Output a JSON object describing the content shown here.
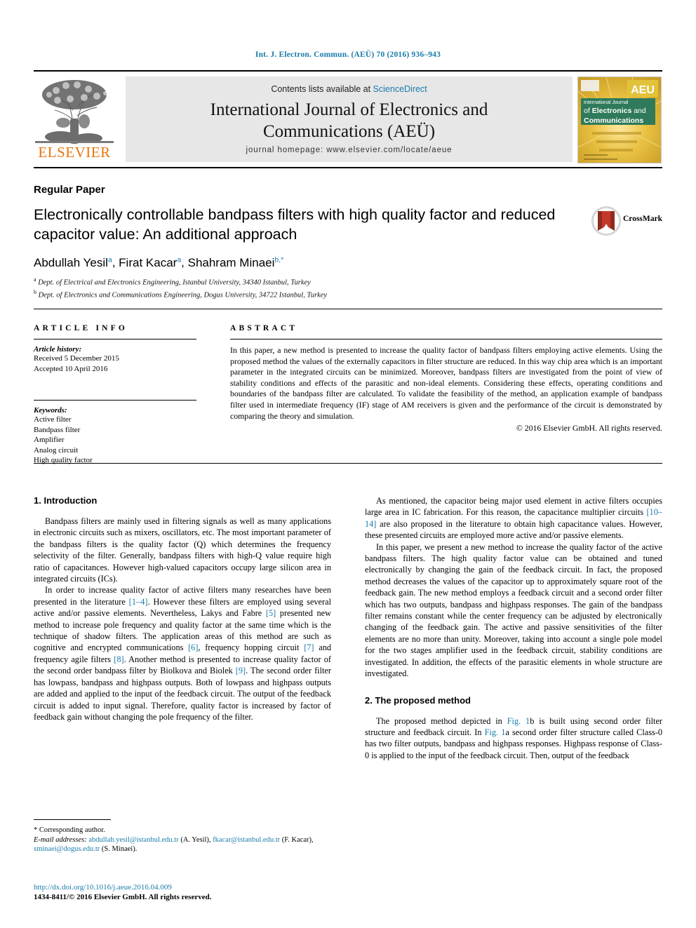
{
  "running_head": "Int. J. Electron. Commun. (AEÜ) 70 (2016) 936–943",
  "masthead": {
    "publisher_name": "ELSEVIER",
    "contents_prefix": "Contents lists available at ",
    "contents_link": "ScienceDirect",
    "journal_title_line1": "International Journal of Electronics and",
    "journal_title_line2": "Communications (AEÜ)",
    "homepage": "journal homepage: www.elsevier.com/locate/aeue",
    "cover_line1": "International Journal",
    "cover_line2": "of Electronics and",
    "cover_line3": "Communications",
    "cover_badge": "AEU"
  },
  "title_block": {
    "paper_kind": "Regular Paper",
    "title": "Electronically controllable bandpass filters with high quality factor and reduced capacitor value: An additional approach",
    "crossmark_label": "CrossMark",
    "authors": [
      {
        "name": "Abdullah Yesil",
        "marks": "a"
      },
      {
        "name": "Firat Kacar",
        "marks": "a"
      },
      {
        "name": "Shahram Minaei",
        "marks": "b,*"
      }
    ],
    "affiliations": [
      {
        "mark": "a",
        "text": "Dept. of Electrical and Electronics Engineering, Istanbul University, 34340 Istanbul, Turkey"
      },
      {
        "mark": "b",
        "text": "Dept. of Electronics and Communications Engineering, Dogus University, 34722 Istanbul, Turkey"
      }
    ]
  },
  "article_info": {
    "heading": "ARTICLE INFO",
    "history_label": "Article history:",
    "history_lines": [
      "Received 5 December 2015",
      "Accepted 10 April 2016"
    ],
    "keywords_label": "Keywords:",
    "keywords": [
      "Active filter",
      "Bandpass filter",
      "Amplifier",
      "Analog circuit",
      "High quality factor"
    ]
  },
  "abstract": {
    "heading": "ABSTRACT",
    "text": "In this paper, a new method is presented to increase the quality factor of bandpass filters employing active elements. Using the proposed method the values of the externally capacitors in filter structure are reduced. In this way chip area which is an important parameter in the integrated circuits can be minimized. Moreover, bandpass filters are investigated from the point of view of stability conditions and effects of the parasitic and non-ideal elements. Considering these effects, operating conditions and boundaries of the bandpass filter are calculated. To validate the feasibility of the method, an application example of bandpass filter used in intermediate frequency (IF) stage of AM receivers is given and the performance of the circuit is demonstrated by comparing the theory and simulation.",
    "copyright": "© 2016 Elsevier GmbH. All rights reserved."
  },
  "body": {
    "section1_heading": "1. Introduction",
    "section1_p1": "Bandpass filters are mainly used in filtering signals as well as many applications in electronic circuits such as mixers, oscillators, etc. The most important parameter of the bandpass filters is the quality factor (Q) which determines the frequency selectivity of the filter. Generally, bandpass filters with high-Q value require high ratio of capacitances. However high-valued capacitors occupy large silicon area in integrated circuits (ICs).",
    "section1_p2_a": "In order to increase quality factor of active filters many researches have been presented in the literature ",
    "ref_1_4": "[1–4]",
    "section1_p2_b": ". However these filters are employed using several active and/or passive elements. Nevertheless, Lakys and Fabre ",
    "ref_5": "[5]",
    "section1_p2_c": " presented new method to increase pole frequency and quality factor at the same time which is the technique of shadow filters. The application areas of this method are such as cognitive and encrypted communications ",
    "ref_6": "[6]",
    "section1_p2_d": ", frequency hopping circuit ",
    "ref_7": "[7]",
    "section1_p2_e": " and frequency agile filters ",
    "ref_8": "[8]",
    "section1_p2_f": ". Another method is presented to increase quality factor of the second order bandpass filter by Biolkova and Biolek ",
    "ref_9": "[9]",
    "section1_p2_g": ". The second order filter has lowpass, bandpass and highpass outputs. Both of lowpass and highpass outputs are added and applied to the input of the feedback circuit. The output of the feedback circuit is added to input signal. Therefore, quality factor is increased by factor of feedback gain without changing the pole frequency of the filter.",
    "right_p1_a": "As mentioned, the capacitor being major used element in active filters occupies large area in IC fabrication. For this reason, the capacitance multiplier circuits ",
    "ref_10_14": "[10–14]",
    "right_p1_b": " are also proposed in the literature to obtain high capacitance values. However, these presented circuits are employed more active and/or passive elements.",
    "right_p2": "In this paper, we present a new method to increase the quality factor of the active bandpass filters. The high quality factor value can be obtained and tuned electronically by changing the gain of the feedback circuit. In fact, the proposed method decreases the values of the capacitor up to approximately square root of the feedback gain. The new method employs a feedback circuit and a second order filter which has two outputs, bandpass and highpass responses. The gain of the bandpass filter remains constant while the center frequency can be adjusted by electronically changing of the feedback gain. The active and passive sensitivities of the filter elements are no more than unity. Moreover, taking into account a single pole model for the two stages amplifier used in the feedback circuit, stability conditions are investigated. In addition, the effects of the parasitic elements in whole structure are investigated.",
    "section2_heading": "2. The proposed method",
    "section2_p1_a": "The proposed method depicted in ",
    "fig_1b": "Fig. 1",
    "section2_p1_b": "b is built using second order filter structure and feedback circuit. In ",
    "fig_1a": "Fig. 1",
    "section2_p1_c": "a second order filter structure called Class-0 has two filter outputs, bandpass and highpass responses. Highpass response of Class-0 is applied to the input of the feedback circuit. Then, output of the feedback"
  },
  "footnote": {
    "corresponding": "* Corresponding author.",
    "email_label": "E-mail addresses:",
    "email_1": "abdullah.yesil@istanbul.edu.tr",
    "email_1_who": " (A. Yesil), ",
    "email_2": "fkacar@istanbul.edu.tr",
    "email_2_who": " (F. Kacar), ",
    "email_3": "sminaei@dogus.edu.tr",
    "email_3_who": " (S. Minaei)."
  },
  "footer": {
    "doi": "http://dx.doi.org/10.1016/j.aeue.2016.04.009",
    "issn": "1434-8411/© 2016 Elsevier GmbH. All rights reserved."
  },
  "colors": {
    "link": "#1a7bab",
    "elsevier_orange": "#e8740c",
    "panel_grey": "#e7e7e7"
  }
}
